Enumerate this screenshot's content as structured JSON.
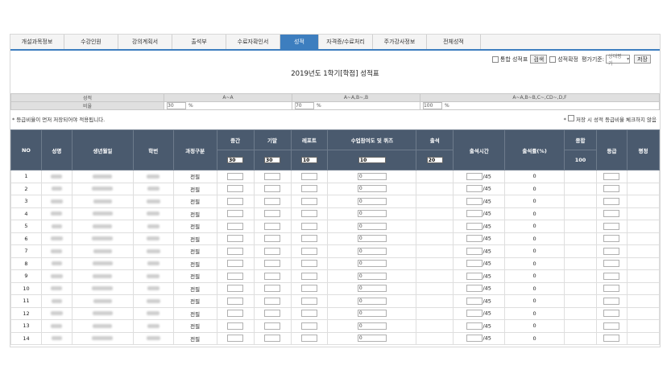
{
  "tabs": [
    {
      "label": "개설과목정보",
      "active": false
    },
    {
      "label": "수강인원",
      "active": false
    },
    {
      "label": "강의계획서",
      "active": false
    },
    {
      "label": "출석부",
      "active": false
    },
    {
      "label": "수료자확인서",
      "active": false
    },
    {
      "label": "성적",
      "active": true
    },
    {
      "label": "자격증/수료처리",
      "active": false
    },
    {
      "label": "주가강사정보",
      "active": false
    },
    {
      "label": "전체성적",
      "active": false
    }
  ],
  "controls": {
    "combined_grade_label": "통합 성적표",
    "search_button": "검색",
    "grade_confirm_label": "성적확정",
    "eval_basis_label": "평가기준:",
    "eval_basis_value": "상대평가",
    "save_button": "저장"
  },
  "page_title": "2019년도 1학기[학점] 성적표",
  "ratio_table": {
    "row1_label": "성적",
    "row2_label": "비율",
    "groups": [
      {
        "grades": "A~A",
        "value": "30",
        "unit": "%"
      },
      {
        "grades": "A~A,B~,B",
        "value": "70",
        "unit": "%"
      },
      {
        "grades": "A~A,B~B,C~,CD~,D,F",
        "value": "100",
        "unit": "%"
      }
    ]
  },
  "note_left": "* 등급비율이 먼저 저장되어야 적용됩니다.",
  "note_right": "저장 시 성적 등급비율 체크하지 않음",
  "table": {
    "headers": {
      "no": "NO",
      "name": "성명",
      "birth": "생년월일",
      "student_id": "학번",
      "course_type": "과정구분",
      "midterm": "중간",
      "final": "기말",
      "report": "레포트",
      "participation": "수업참여도 및 퀴즈",
      "attendance": "출석",
      "attend_time": "출석시간",
      "attend_rate": "출석률(%)",
      "total": "종합",
      "grade": "등급",
      "eval": "평정"
    },
    "weights": {
      "midterm": "30",
      "final": "30",
      "report": "10",
      "participation": "10",
      "attendance": "20",
      "total": "100"
    },
    "rows": [
      {
        "no": "1",
        "course_type": "전필",
        "participation": "0",
        "attend_max": "/45",
        "attend_rate": "0"
      },
      {
        "no": "2",
        "course_type": "전필",
        "participation": "0",
        "attend_max": "/45",
        "attend_rate": "0"
      },
      {
        "no": "3",
        "course_type": "전필",
        "participation": "0",
        "attend_max": "/45",
        "attend_rate": "0"
      },
      {
        "no": "4",
        "course_type": "전필",
        "participation": "0",
        "attend_max": "/45",
        "attend_rate": "0"
      },
      {
        "no": "5",
        "course_type": "전필",
        "participation": "0",
        "attend_max": "/45",
        "attend_rate": "0"
      },
      {
        "no": "6",
        "course_type": "전필",
        "participation": "0",
        "attend_max": "/45",
        "attend_rate": "0"
      },
      {
        "no": "7",
        "course_type": "전필",
        "participation": "0",
        "attend_max": "/45",
        "attend_rate": "0"
      },
      {
        "no": "8",
        "course_type": "전필",
        "participation": "0",
        "attend_max": "/45",
        "attend_rate": "0"
      },
      {
        "no": "9",
        "course_type": "전필",
        "participation": "0",
        "attend_max": "/45",
        "attend_rate": "0"
      },
      {
        "no": "10",
        "course_type": "전필",
        "participation": "0",
        "attend_max": "/45",
        "attend_rate": "0"
      },
      {
        "no": "11",
        "course_type": "전필",
        "participation": "0",
        "attend_max": "/45",
        "attend_rate": "0"
      },
      {
        "no": "12",
        "course_type": "전필",
        "participation": "0",
        "attend_max": "/45",
        "attend_rate": "0"
      },
      {
        "no": "13",
        "course_type": "전필",
        "participation": "0",
        "attend_max": "/45",
        "attend_rate": "0"
      },
      {
        "no": "14",
        "course_type": "전필",
        "participation": "0",
        "attend_max": "/45",
        "attend_rate": "0"
      }
    ]
  }
}
